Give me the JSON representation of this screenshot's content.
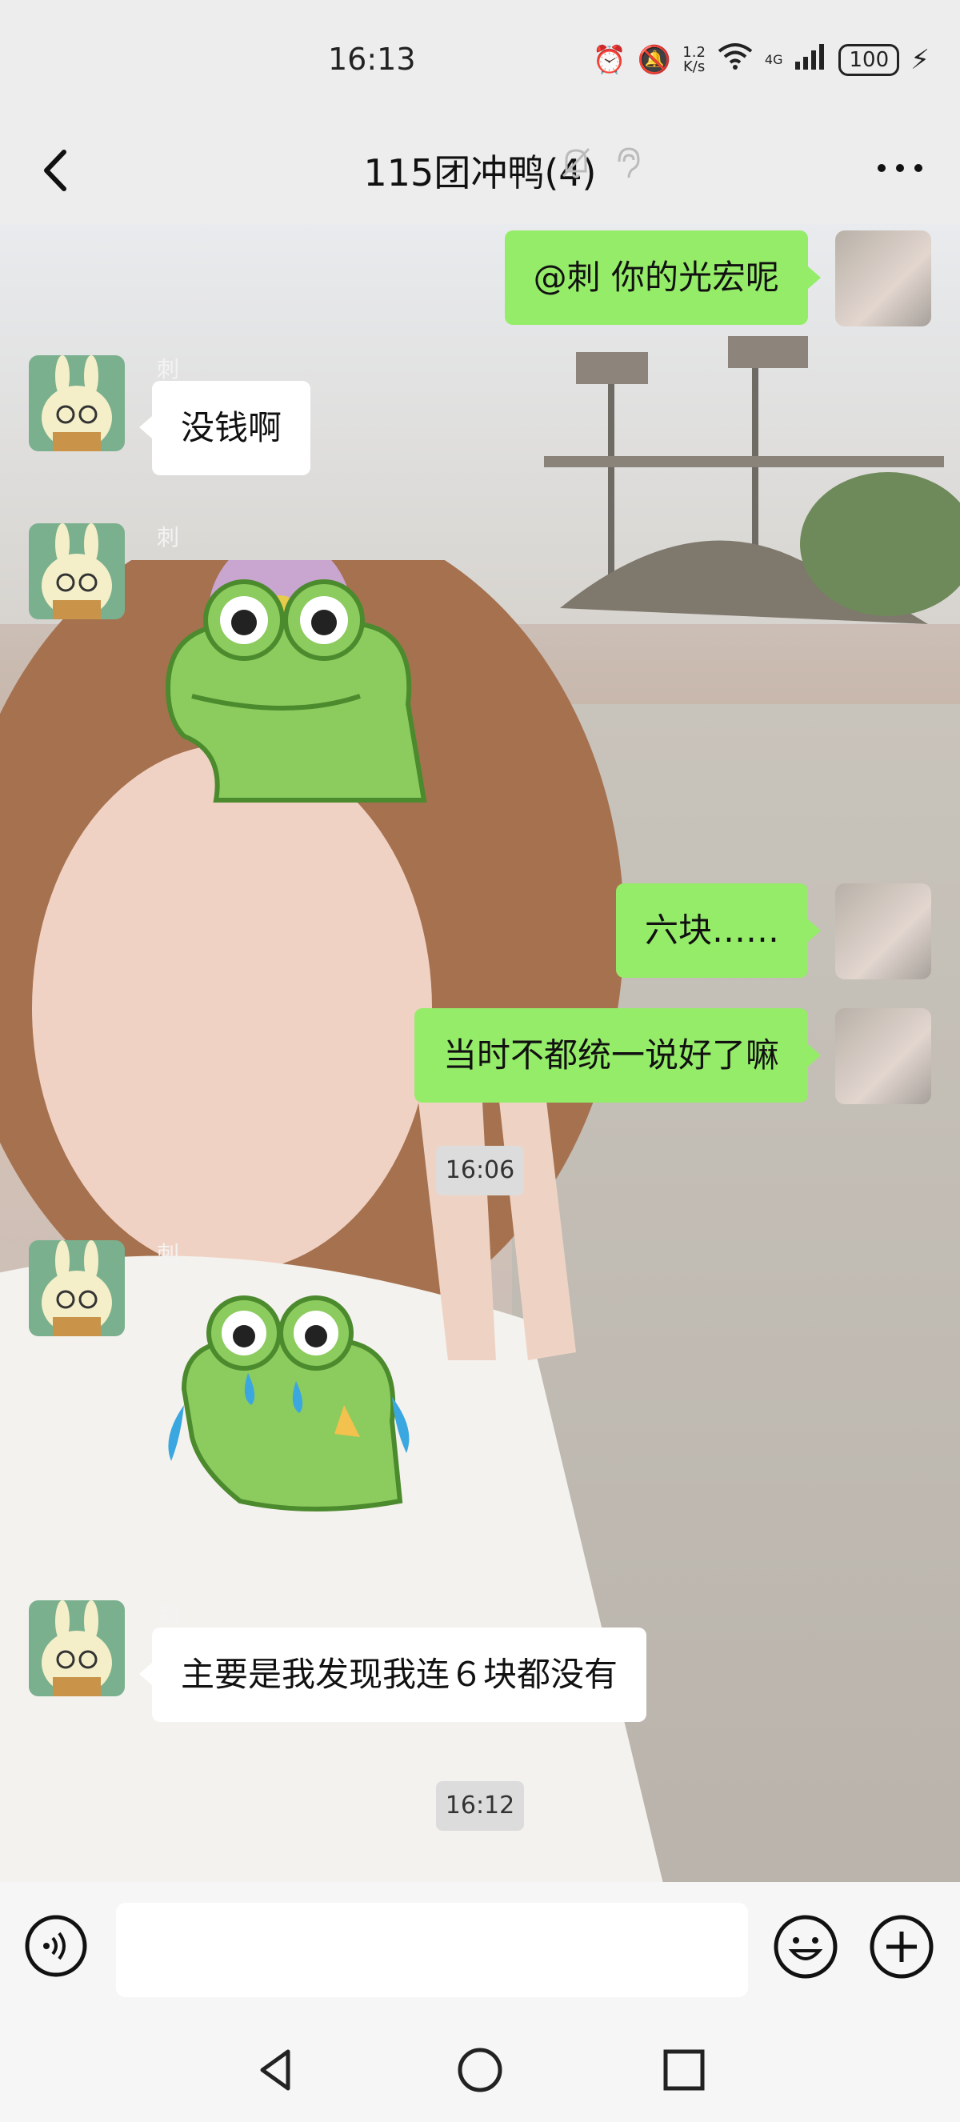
{
  "status": {
    "time": "16:13",
    "net_speed_top": "1.2",
    "net_speed_bottom": "K/s",
    "wifi_label": "6",
    "signal_label": "4G",
    "battery": "100"
  },
  "header": {
    "title": "115团冲鸭(4)"
  },
  "messages": [
    {
      "side": "right",
      "text": "@刺  你的光宏呢"
    },
    {
      "side": "left",
      "sender": "刺",
      "text": "没钱啊"
    },
    {
      "side": "left",
      "sender": "刺",
      "sticker": "crocodile-smile-sticker"
    },
    {
      "side": "right",
      "text": "六块……"
    },
    {
      "side": "right",
      "text": "当时不都统一说好了嘛"
    },
    {
      "side": "left",
      "sender": "刺",
      "sticker": "crocodile-crying-sticker"
    },
    {
      "side": "left",
      "sender": "刺",
      "text": "主要是我发现我连６块都没有"
    }
  ],
  "timestamps": [
    "16:06",
    "16:12"
  ],
  "icons": {
    "back": "chevron-left-icon",
    "mute": "bell-off-icon",
    "ear": "ear-icon",
    "more": "more-dots-icon",
    "voice": "voice-icon",
    "emoji": "emoji-icon",
    "plus": "plus-icon"
  },
  "colors": {
    "my_bubble": "#95ec69",
    "their_bubble": "#ffffff",
    "header_bg": "#ededed"
  }
}
